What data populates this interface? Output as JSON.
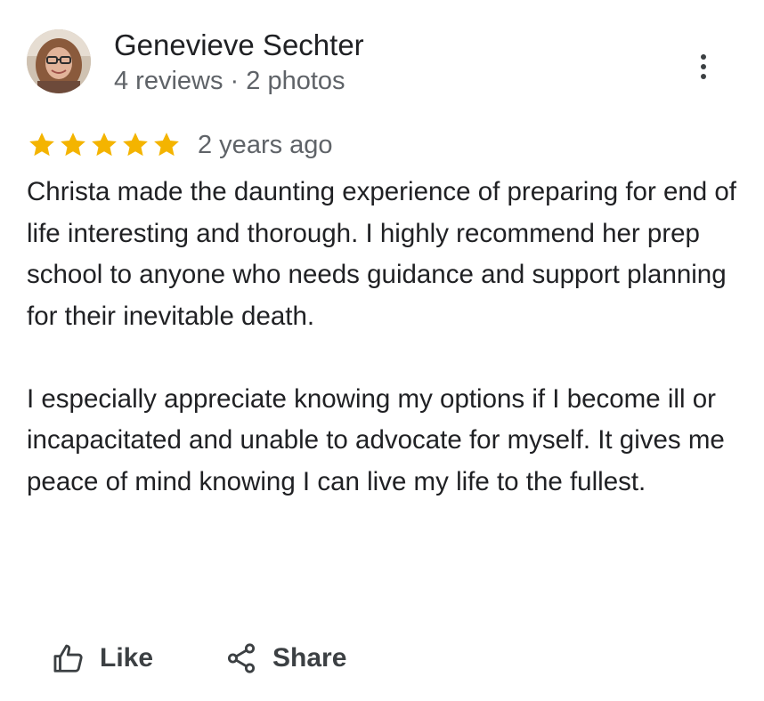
{
  "review": {
    "author": {
      "name": "Genevieve Sechter",
      "meta": "4 reviews · 2 photos",
      "avatar_icon": "profile-photo"
    },
    "rating": {
      "stars": 5,
      "max_stars": 5,
      "star_color": "#F4B400",
      "time_ago": "2 years ago"
    },
    "body": [
      "Christa made the daunting experience of preparing for end of life interesting and thorough. I highly recommend her prep school to anyone who needs guidance and support planning for their inevitable death.",
      "I especially appreciate knowing my options if I become ill or incapacitated and unable to advocate for myself. It gives me peace of mind knowing I can live my life to the fullest."
    ],
    "more_icon": "more-vert-icon"
  },
  "actions": {
    "like_label": "Like",
    "like_icon": "thumbs-up-icon",
    "share_label": "Share",
    "share_icon": "share-icon"
  }
}
